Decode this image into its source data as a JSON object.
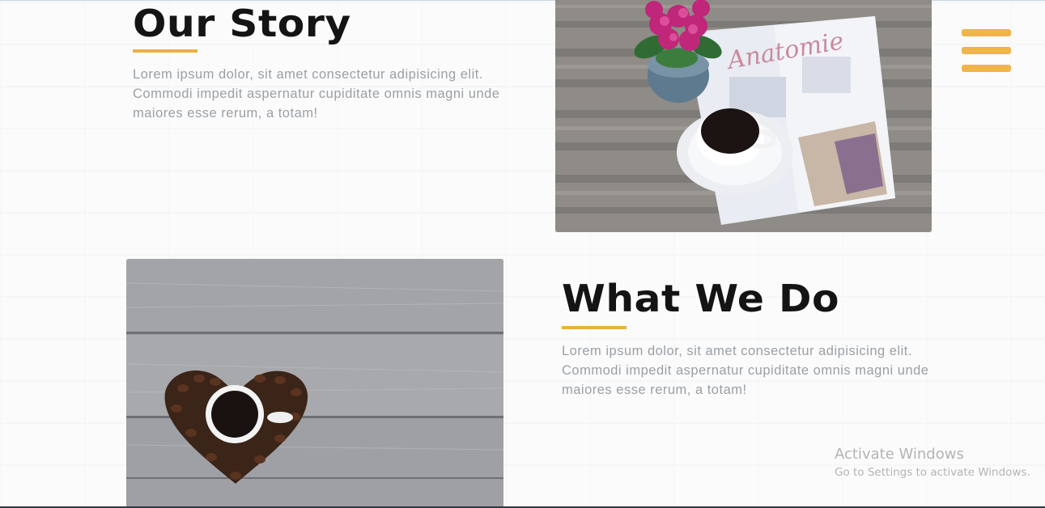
{
  "sections": {
    "our_story": {
      "title": "Our Story",
      "text": "Lorem ipsum dolor, sit amet consectetur adipisicing elit. Commodi impedit aspernatur cupiditate omnis magni unde maiores esse rerum, a totam!",
      "image": "coffee-and-magazine-photo"
    },
    "what_we_do": {
      "title": "What We Do",
      "text": "Lorem ipsum dolor, sit amet consectetur adipisicing elit. Commodi impedit aspernatur cupiditate omnis magni unde maiores esse rerum, a totam!",
      "image": "coffee-bean-heart-photo"
    }
  },
  "nav": {
    "menu_icon": "hamburger-menu-icon"
  },
  "watermark": {
    "title": "Activate Windows",
    "subtitle": "Go to Settings to activate Windows."
  },
  "colors": {
    "accent": "#eab041",
    "menu": "#efb44c",
    "heading": "#141414",
    "body_text": "#9aa0a6"
  }
}
